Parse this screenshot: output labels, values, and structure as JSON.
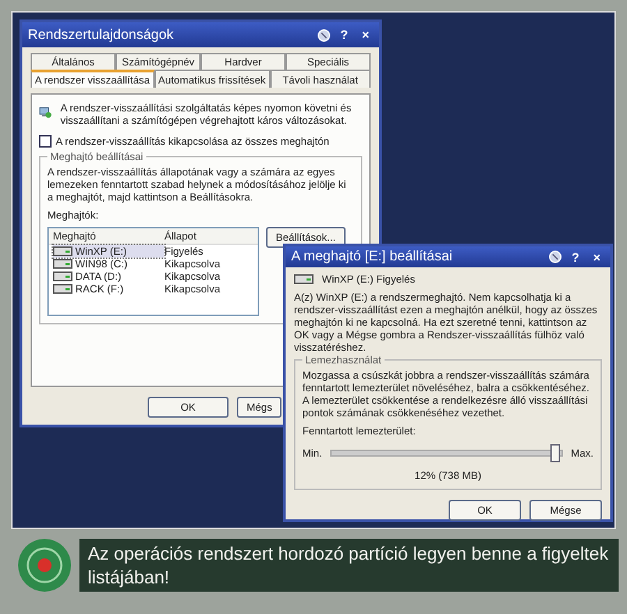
{
  "system_properties": {
    "title": "Rendszertulajdonságok",
    "help_button": "?",
    "close_button": "×",
    "tab_rows": [
      [
        {
          "label": "Általános",
          "selected": false
        },
        {
          "label": "Számítógépnév",
          "selected": false
        },
        {
          "label": "Hardver",
          "selected": false
        },
        {
          "label": "Speciális",
          "selected": false
        }
      ],
      [
        {
          "label": "A rendszer visszaállítása",
          "selected": true
        },
        {
          "label": "Automatikus frissítések",
          "selected": false
        },
        {
          "label": "Távoli használat",
          "selected": false
        }
      ]
    ],
    "intro": "A rendszer-visszaállítási szolgáltatás képes nyomon követni és visszaállítani a számítógépen végrehajtott káros változásokat.",
    "disable_checkbox": {
      "label": "A rendszer-visszaállítás kikapcsolása az összes meghajtón",
      "checked": false
    },
    "group": {
      "title": "Meghajtó beállításai",
      "text": "A rendszer-visszaállítás állapotának vagy a számára az egyes lemezeken fenntartott szabad helynek a módosításához jelölje ki a meghajtót, majd kattintson a Beállításokra.",
      "list_label": "Meghajtók:",
      "columns": [
        "Meghajtó",
        "Állapot"
      ],
      "rows": [
        {
          "drive": "WinXP (E:)",
          "status": "Figyelés",
          "selected": true
        },
        {
          "drive": "WIN98 (C:)",
          "status": "Kikapcsolva",
          "selected": false
        },
        {
          "drive": "DATA (D:)",
          "status": "Kikapcsolva",
          "selected": false
        },
        {
          "drive": "RACK (F:)",
          "status": "Kikapcsolva",
          "selected": false
        }
      ],
      "settings_button": "Beállítások..."
    },
    "buttons": [
      "OK",
      "Mégs"
    ]
  },
  "drive_settings": {
    "title": "A meghajtó [E:] beállításai",
    "help_button": "?",
    "close_button": "×",
    "drive_status": "WinXP (E:)  Figyelés",
    "text": "A(z) WinXP (E:) a rendszermeghajtó. Nem kapcsolhatja ki a rendszer-visszaállítást ezen a meghajtón anélkül, hogy az összes meghajtón ki ne kapcsolná. Ha ezt szeretné tenni, kattintson az OK vagy a Mégse gombra a Rendszer-visszaállítás fülhöz való visszatéréshez.",
    "group": {
      "title": "Lemezhasználat",
      "text": "Mozgassa a csúszkát jobbra a rendszer-visszaállítás számára fenntartott lemezterület növeléséhez, balra a csökkentéséhez. A lemezterület csökkentése a rendelkezésre álló visszaállítási pontok számának csökkenéséhez vezethet.",
      "slider_label": "Fenntartott lemezterület:",
      "min_label": "Min.",
      "max_label": "Max.",
      "level": 0.97,
      "reading": "12% (738 MB)"
    },
    "buttons": [
      "OK",
      "Mégse"
    ]
  },
  "caption": "Az operációs rendszert hordozó partíció legyen benne a figyeltek listájában!"
}
